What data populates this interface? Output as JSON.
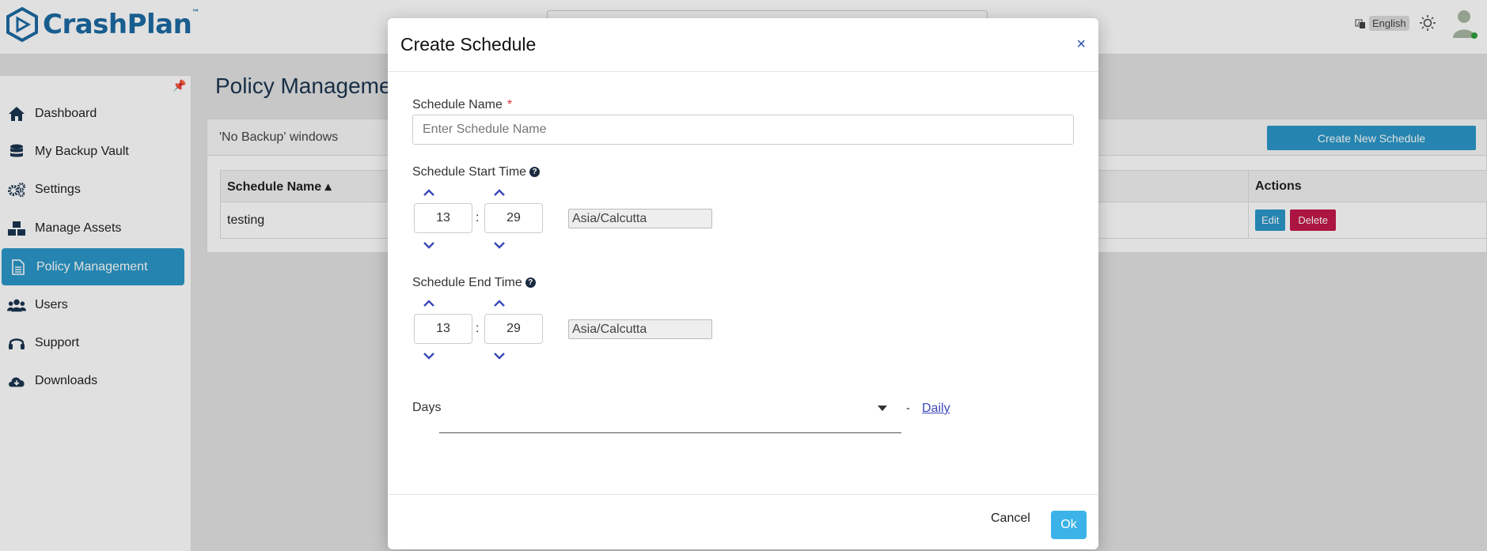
{
  "app": {
    "logo_text": "CrashPlan",
    "logo_tm": "™",
    "language": "English"
  },
  "sidebar": {
    "items": [
      {
        "label": "Dashboard",
        "icon": "home-icon"
      },
      {
        "label": "My Backup Vault",
        "icon": "database-icon"
      },
      {
        "label": "Settings",
        "icon": "gears-icon"
      },
      {
        "label": "Manage Assets",
        "icon": "cubes-icon"
      },
      {
        "label": "Policy Management",
        "icon": "document-icon"
      },
      {
        "label": "Users",
        "icon": "users-icon"
      },
      {
        "label": "Support",
        "icon": "headset-icon"
      },
      {
        "label": "Downloads",
        "icon": "cloud-download-icon"
      }
    ],
    "active_index": 4
  },
  "page": {
    "title": "Policy Management",
    "panel_title": "'No Backup' windows",
    "create_button": "Create New Schedule",
    "table": {
      "col_name": "Schedule Name",
      "col_actions": "Actions",
      "rows": [
        {
          "name": "testing"
        }
      ],
      "edit_label": "Edit",
      "delete_label": "Delete"
    }
  },
  "modal": {
    "title": "Create Schedule",
    "close": "×",
    "name_label": "Schedule Name",
    "required_mark": "*",
    "name_placeholder": "Enter Schedule Name",
    "name_value": "",
    "start_label": "Schedule Start Time",
    "start_hour": "13",
    "start_minute": "29",
    "start_tz": "Asia/Calcutta",
    "end_label": "Schedule End Time",
    "end_hour": "13",
    "end_minute": "29",
    "end_tz": "Asia/Calcutta",
    "time_separator": ":",
    "help_glyph": "?",
    "days_label": "Days",
    "days_dash": "-",
    "days_link": "Daily",
    "cancel": "Cancel",
    "ok": "Ok"
  },
  "colors": {
    "brand": "#1c6aa3",
    "accent": "#2b98c9",
    "danger": "#c4184a",
    "ok_button": "#3cb3e8",
    "chevron": "#3b49b8"
  }
}
